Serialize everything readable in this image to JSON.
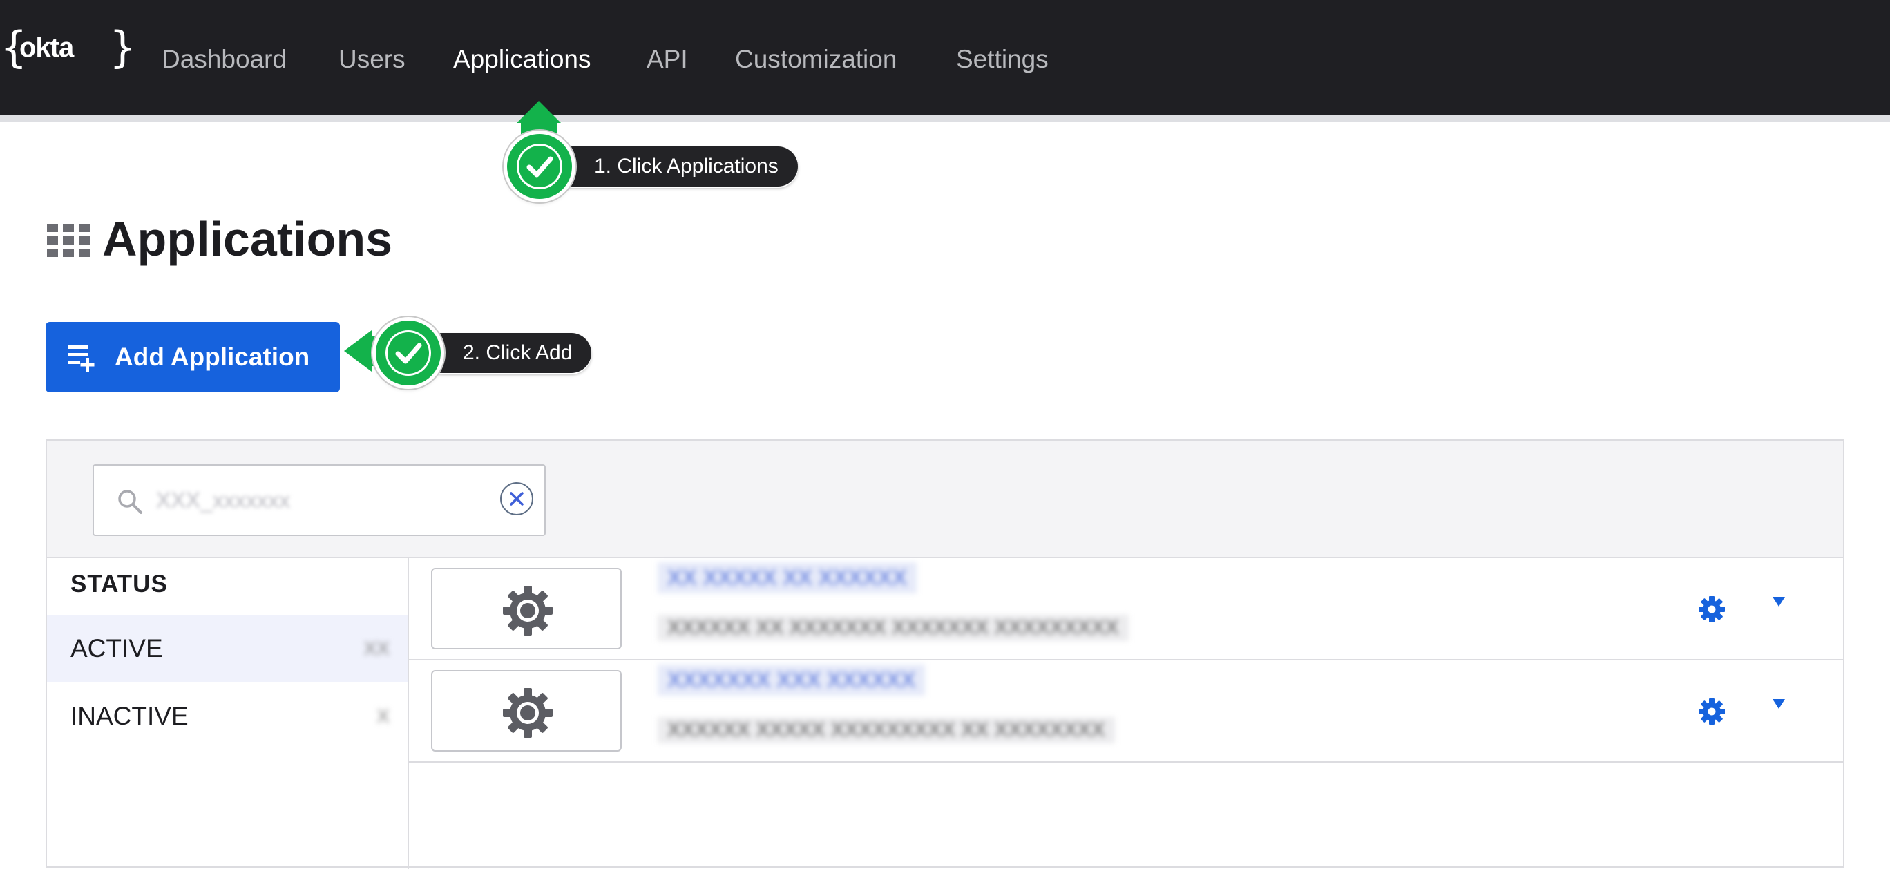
{
  "nav": {
    "logo_text": "okta",
    "items": [
      {
        "label": "Dashboard",
        "active": false
      },
      {
        "label": "Users",
        "active": false
      },
      {
        "label": "Applications",
        "active": true
      },
      {
        "label": "API",
        "active": false
      },
      {
        "label": "Customization",
        "active": false
      },
      {
        "label": "Settings",
        "active": false
      }
    ]
  },
  "callouts": {
    "step1": "1. Click Applications",
    "step2": "2. Click Add"
  },
  "page": {
    "title": "Applications",
    "add_button_label": "Add Application"
  },
  "search": {
    "value": "XXX_xxxxxxx"
  },
  "sidebar": {
    "heading": "STATUS",
    "items": [
      {
        "label": "ACTIVE",
        "count": "XX"
      },
      {
        "label": "INACTIVE",
        "count": "X"
      }
    ]
  },
  "apps": [
    {
      "name": "XX XXXXX XX XXXXXX",
      "description": "XXXXXX XX XXXXXXX XXXXXXX XXXXXXXXX"
    },
    {
      "name": "XXXXXXX XXX XXXXXX",
      "description": "XXXXXX XXXXX XXXXXXXXX XX XXXXXXXX"
    }
  ],
  "colors": {
    "topbar": "#1f1f23",
    "accent": "#1662dd",
    "callout_green": "#13b24b",
    "callout_dark": "#232326"
  }
}
